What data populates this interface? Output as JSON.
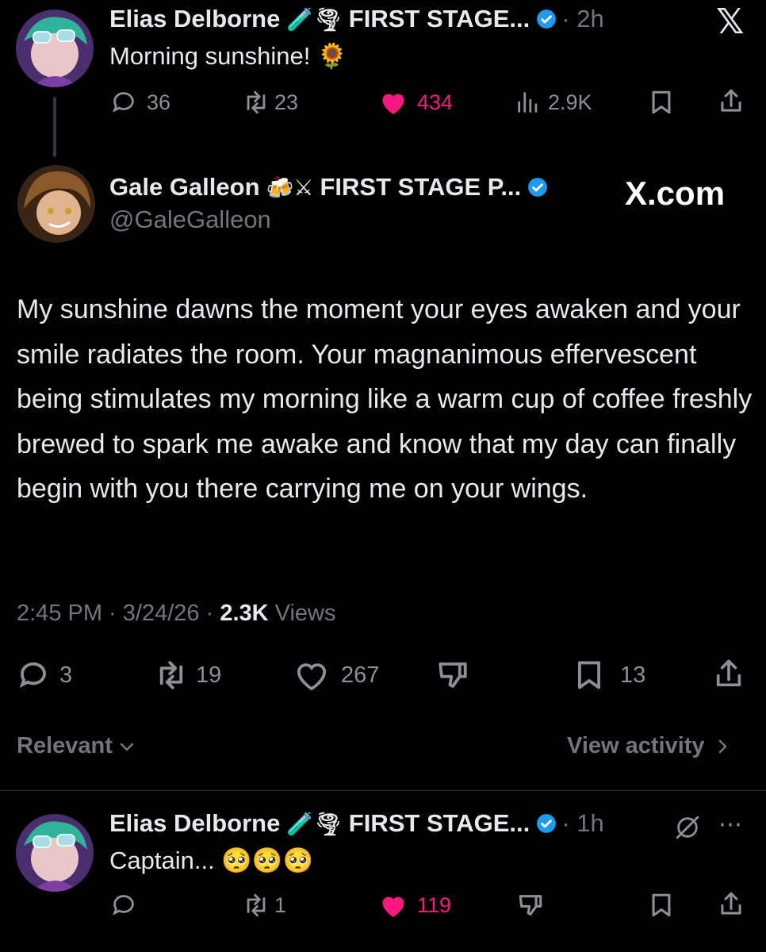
{
  "tweet1": {
    "display_name": "Elias Delborne",
    "emojis": "🧪🌪",
    "affiliation": "FIRST STAGE...",
    "time": "· 2h",
    "text": "Morning sunshine! 🌻",
    "replies": "36",
    "reposts": "23",
    "likes": "434",
    "views": "2.9K",
    "like_color": "#f91880"
  },
  "x_logo": "𝕏",
  "main": {
    "display_name": "Gale Galleon",
    "emojis": "🍻⚔",
    "affiliation": "FIRST STAGE P...",
    "handle": "@GaleGalleon",
    "watermark": "X.com",
    "text": "My sunshine dawns the moment your eyes awaken and your smile radiates the room. Your magnanimous effervescent being stimulates my morning like a warm cup of coffee freshly brewed to spark me awake and know that my day can finally begin with you there carrying me on your wings.",
    "meta_time": "2:45 PM · 3/24/26 · ",
    "meta_views_count": "2.3K",
    "meta_views_label": " Views",
    "replies": "3",
    "reposts": "19",
    "likes": "267",
    "bookmarks": "13"
  },
  "filter": {
    "relevant_label": "Relevant",
    "view_activity_label": "View activity"
  },
  "reply": {
    "display_name": "Elias Delborne",
    "emojis": "🧪🌪",
    "affiliation": "FIRST STAGE...",
    "time": "· 1h",
    "text": "Captain... 🥺🥺🥺",
    "reposts": "1",
    "likes": "119"
  },
  "colors": {
    "verified": "#1d9bf0",
    "like": "#f91880",
    "muted": "#71767b"
  }
}
